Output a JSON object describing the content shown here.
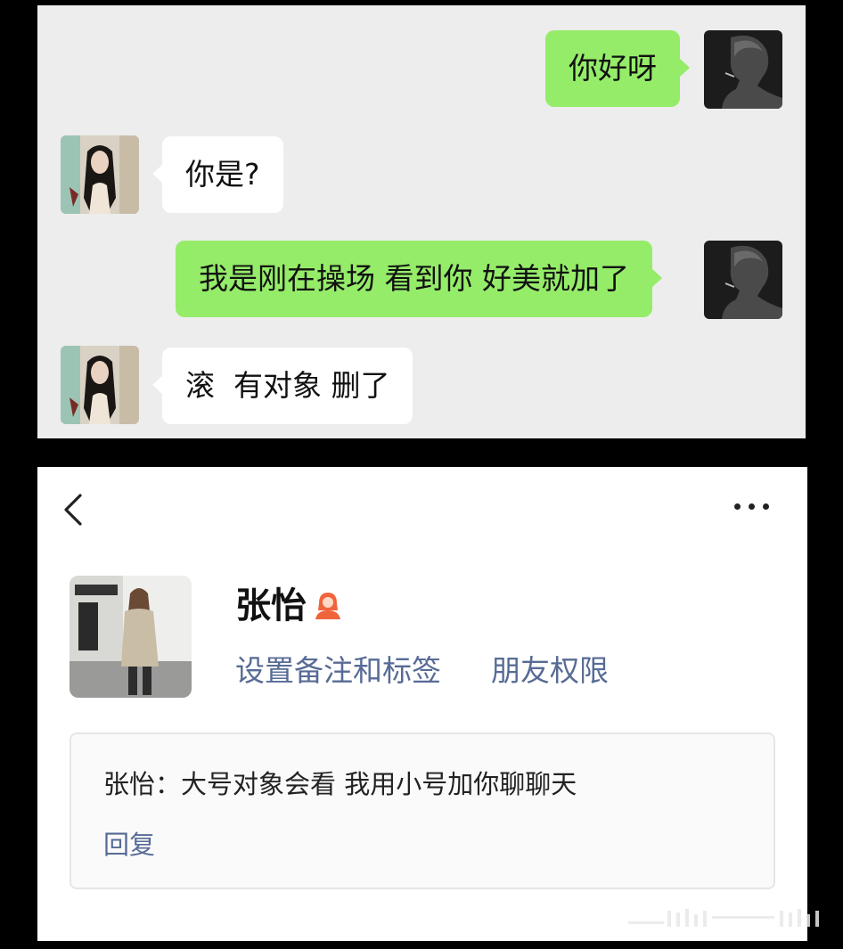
{
  "chat": {
    "messages": [
      {
        "side": "sent",
        "text": "你好呀"
      },
      {
        "side": "received",
        "text": "你是?"
      },
      {
        "side": "sent",
        "text": "我是刚在操场 看到你 好美就加了"
      },
      {
        "side": "received",
        "text": "滚  有对象 删了"
      }
    ]
  },
  "profile": {
    "back_icon": "chevron-left-icon",
    "more_icon": "more-dots-icon",
    "name": "张怡",
    "gender_icon": "female-person-icon",
    "links": {
      "remark": "设置备注和标签",
      "permission": "朋友权限"
    },
    "greeting_message": "张怡：大号对象会看 我用小号加你聊聊天",
    "reply_label": "回复"
  },
  "colors": {
    "sent_bubble": "#95ec69",
    "received_bubble": "#ffffff",
    "chat_background": "#ededed",
    "link": "#576b95",
    "gender_icon": "#f0643c"
  }
}
